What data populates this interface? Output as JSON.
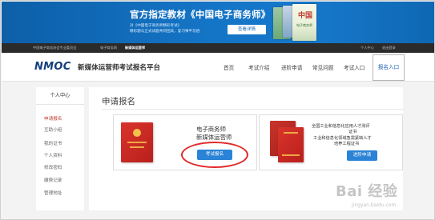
{
  "banner": {
    "title": "官方指定教材《中国电子商务师》",
    "subtitle_line1": "对《中国电子商务师精彩考试》",
    "subtitle_line2": "精彩题与正式试题共同团具，复习事半功倍",
    "cta_label": "查看详情",
    "book_title": "中国",
    "book_subtitle": "电子商务师"
  },
  "topnav": {
    "items": [
      {
        "label": "中国电子商务协会专业委员会"
      },
      {
        "label": "电子商务网"
      },
      {
        "label": "新媒体运营师"
      },
      {
        "label": "个人中心"
      },
      {
        "label": "退出登录"
      }
    ]
  },
  "header": {
    "logo": "NMOC",
    "platform_name": "新媒体运营师考试报名平台",
    "nav": [
      {
        "label": "首页"
      },
      {
        "label": "考试介绍"
      },
      {
        "label": "进阶申请"
      },
      {
        "label": "常见问题"
      },
      {
        "label": "考试入口"
      },
      {
        "label": "报名入口"
      }
    ]
  },
  "sidebar": {
    "title": "个人中心",
    "items": [
      {
        "label": "申请报名"
      },
      {
        "label": "互助小组"
      },
      {
        "label": "我的证书"
      },
      {
        "label": "个人资料"
      },
      {
        "label": "修改密码"
      },
      {
        "label": "缴费记录"
      },
      {
        "label": "管理地址"
      }
    ]
  },
  "main": {
    "title": "申请报名",
    "cards": [
      {
        "line1": "电子商务师",
        "line2": "新媒体运营师",
        "button": "考试报名"
      },
      {
        "line1": "全国工业和信息化应用人才测评",
        "line2": "证书",
        "line3": "工业和信息化领域急需紧缺人才",
        "line4": "培养工程证书",
        "button": "进阶申请"
      }
    ]
  },
  "watermark": {
    "text": "Bai 经验",
    "sub": "jingyan.baidu.com"
  },
  "colors": {
    "banner_blue": "#1473c4",
    "nav_active_blue": "#1c62b9",
    "button_blue": "#2a83d6",
    "highlight_red": "#e02a2a",
    "logo_navy": "#14407c"
  }
}
